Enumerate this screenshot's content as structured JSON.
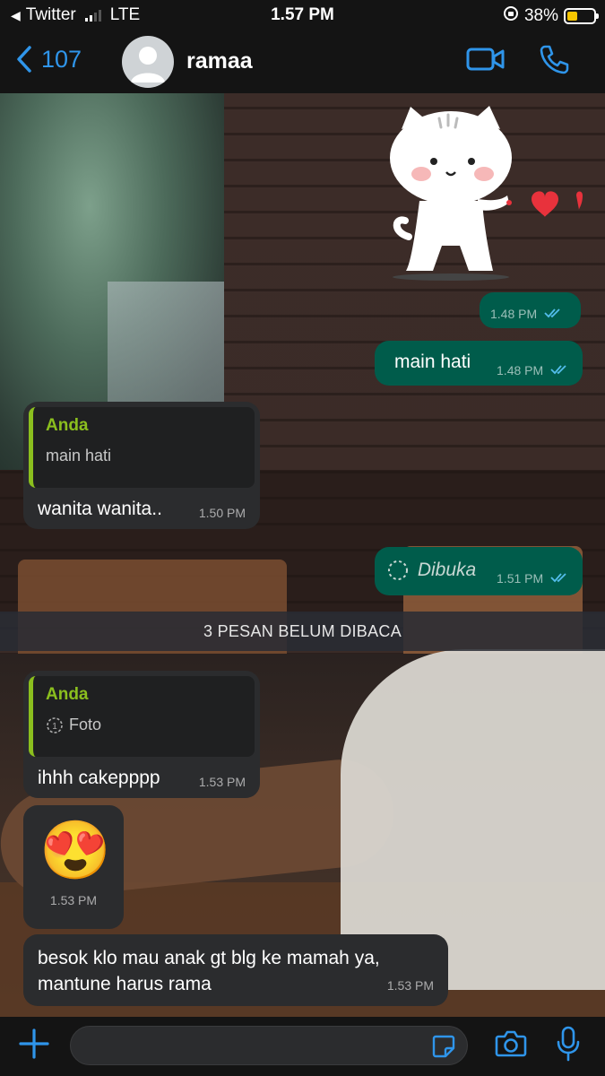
{
  "status_bar": {
    "carrier_back": "Twitter",
    "network": "LTE",
    "time": "1.57 PM",
    "battery": "38%",
    "battery_level": 0.38
  },
  "header": {
    "back_count": "107",
    "contact_name": "ramaa"
  },
  "messages": [
    {
      "type": "sticker",
      "direction": "out"
    },
    {
      "type": "sticker-time",
      "direction": "out",
      "time": "1.48 PM"
    },
    {
      "type": "text",
      "direction": "out",
      "text": "main hati",
      "time": "1.48 PM"
    },
    {
      "type": "reply",
      "direction": "in",
      "quote_author": "Anda",
      "quote_text": "main hati",
      "text": "wanita wanita..",
      "time": "1.50 PM"
    },
    {
      "type": "view-once",
      "direction": "out",
      "text": "Dibuka",
      "time": "1.51 PM"
    }
  ],
  "unread_banner": "3 PESAN BELUM DIBACA",
  "messages_after": [
    {
      "type": "reply",
      "direction": "in",
      "quote_author": "Anda",
      "quote_text": "Foto",
      "text": "ihhh cakepppp",
      "time": "1.53 PM"
    },
    {
      "type": "emoji",
      "direction": "in",
      "emoji": "😍",
      "time": "1.53 PM"
    },
    {
      "type": "text",
      "direction": "in",
      "text_line1": "besok klo mau anak gt blg ke mamah ya,",
      "text_line2": "mantune harus rama",
      "time": "1.53 PM"
    }
  ],
  "colors": {
    "accent": "#2f95ea",
    "outgoing_bubble": "#005c4b",
    "incoming_bubble": "#2b2c2e",
    "quote_accent": "#8bbf1e"
  },
  "icons": [
    "back-chevron-icon",
    "avatar-icon",
    "video-call-icon",
    "phone-icon",
    "plus-icon",
    "sticker-icon",
    "camera-icon",
    "microphone-icon",
    "double-check-icon",
    "view-once-icon"
  ]
}
